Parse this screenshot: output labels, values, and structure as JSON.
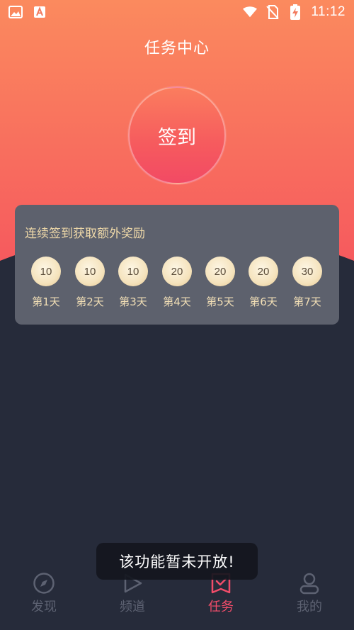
{
  "status_bar": {
    "time": "11:12",
    "left_icons": [
      "image-icon",
      "text-a-icon"
    ],
    "right_icons": [
      "wifi-icon",
      "no-sim-icon",
      "battery-charging-icon"
    ]
  },
  "header": {
    "title": "任务中心"
  },
  "sign_in": {
    "label": "签到"
  },
  "rewards": {
    "title": "连续签到获取额外奖励",
    "days": [
      {
        "value": "10",
        "label": "第1天"
      },
      {
        "value": "10",
        "label": "第2天"
      },
      {
        "value": "10",
        "label": "第3天"
      },
      {
        "value": "20",
        "label": "第4天"
      },
      {
        "value": "20",
        "label": "第5天"
      },
      {
        "value": "20",
        "label": "第6天"
      },
      {
        "value": "30",
        "label": "第7天"
      }
    ]
  },
  "toast": {
    "message": "该功能暂未开放!"
  },
  "nav": {
    "items": [
      {
        "label": "发现",
        "icon": "compass-icon",
        "active": false
      },
      {
        "label": "频道",
        "icon": "play-icon",
        "active": false
      },
      {
        "label": "任务",
        "icon": "task-icon",
        "active": true
      },
      {
        "label": "我的",
        "icon": "user-icon",
        "active": false
      }
    ]
  },
  "colors": {
    "accent": "#f24d6a",
    "gradient_top": "#fb8a5e",
    "gradient_bottom": "#f65a5e",
    "background": "#262b3a",
    "card": "#5d616d",
    "gold_text": "#eed8a8"
  }
}
